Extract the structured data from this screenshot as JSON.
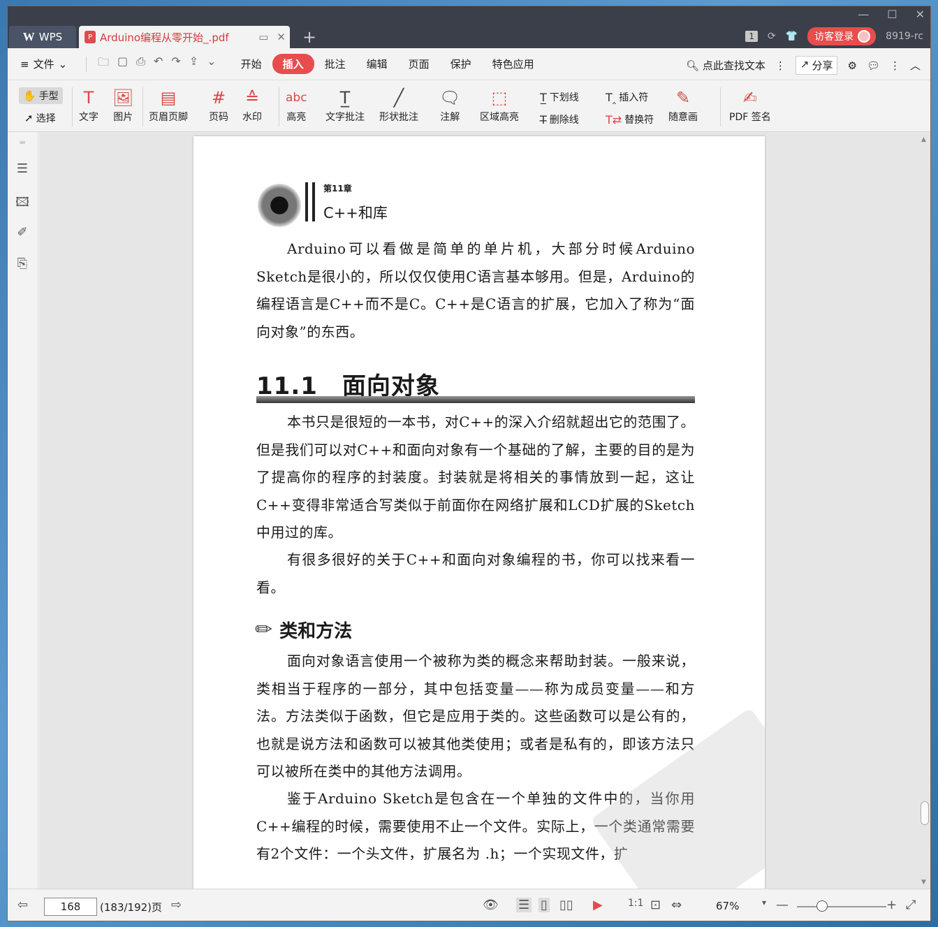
{
  "titlebar": {
    "app_name": "WPS",
    "doc_tab": "Arduino编程从零开始_.pdf",
    "badge_num": "1",
    "login": "访客登录",
    "version": "8919-rc"
  },
  "menubar": {
    "file": "文件",
    "tabs": [
      "开始",
      "插入",
      "批注",
      "编辑",
      "页面",
      "保护",
      "特色应用"
    ],
    "active_tab": "插入",
    "search": "点此查找文本",
    "share": "分享"
  },
  "ribbon": {
    "hand": "手型",
    "select": "选择",
    "text": "文字",
    "image": "图片",
    "header_footer": "页眉页脚",
    "page_num": "页码",
    "watermark": "水印",
    "highlight": "高亮",
    "text_annot": "文字批注",
    "shape_annot": "形状批注",
    "note": "注解",
    "area_highlight": "区域高亮",
    "underline": "下划线",
    "strikethrough": "删除线",
    "insert_mark": "插入符",
    "replace_mark": "替换符",
    "freehand": "随意画",
    "pdf_sign": "PDF 签名"
  },
  "page": {
    "chapter_no": "第11章",
    "chapter_title": "C++和库",
    "intro": "Arduino可以看做是简单的单片机，大部分时候Arduino Sketch是很小的，所以仅仅使用C语言基本够用。但是，Arduino的编程语言是C++而不是C。C++是C语言的扩展，它加入了称为“面向对象”的东西。",
    "section_title": "11.1　面向对象",
    "p1": "本书只是很短的一本书，对C++的深入介绍就超出它的范围了。但是我们可以对C++和面向对象有一个基础的了解，主要的目的是为了提高你的程序的封装度。封装就是将相关的事情放到一起，这让C++变得非常适合写类似于前面你在网络扩展和LCD扩展的Sketch中用过的库。",
    "p2": "有很多很好的关于C++和面向对象编程的书，你可以找来看一看。",
    "subsection_title": "类和方法",
    "p3": "面向对象语言使用一个被称为类的概念来帮助封装。一般来说，类相当于程序的一部分，其中包括变量——称为成员变量——和方法。方法类似于函数，但它是应用于类的。这些函数可以是公有的，也就是说方法和函数可以被其他类使用；或者是私有的，即该方法只可以被所在类中的其他方法调用。",
    "p4": "鉴于Arduino Sketch是包含在一个单独的文件中的，当你用C++编程的时候，需要使用不止一个文件。实际上，一个类通常需要有2个文件：一个头文件，扩展名为 .h；一个实现文件，扩"
  },
  "statusbar": {
    "page_input": "168",
    "page_total": "(183/192)页",
    "zoom": "67%"
  }
}
